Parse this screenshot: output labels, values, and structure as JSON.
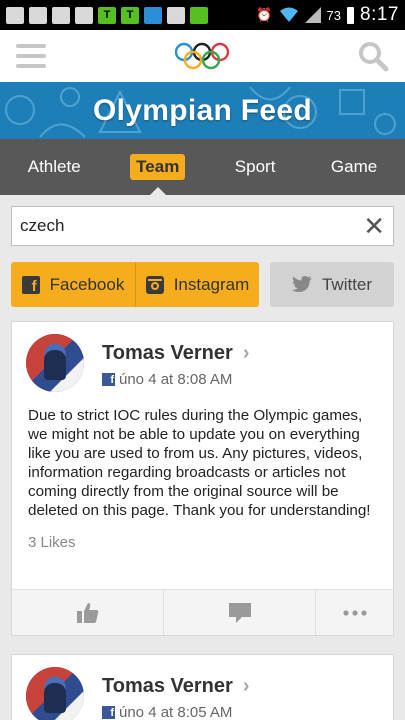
{
  "status_bar": {
    "battery": "73",
    "time": "8:17"
  },
  "banner": {
    "title": "Olympian Feed"
  },
  "tabs": [
    {
      "label": "Athlete"
    },
    {
      "label": "Team"
    },
    {
      "label": "Sport"
    },
    {
      "label": "Game"
    }
  ],
  "search": {
    "value": "czech"
  },
  "social_buttons": {
    "facebook": "Facebook",
    "instagram": "Instagram",
    "twitter": "Twitter"
  },
  "posts": [
    {
      "author": "Tomas Verner",
      "timestamp": "úno 4 at 8:08 AM",
      "text": "Due to strict IOC rules during the Olympic games, we might not be able to update you on everything like you are used to from us. Any pictures, videos, information regarding broadcasts or articles  not coming directly from the original source will be deleted on this page. Thank you for understanding!",
      "likes": "3 Likes"
    },
    {
      "author": "Tomas Verner",
      "timestamp": "úno 4 at 8:05 AM"
    }
  ],
  "colors": {
    "accent": "#f5ad1e",
    "tab_bar": "#585858",
    "banner": "#1e7fb8"
  }
}
